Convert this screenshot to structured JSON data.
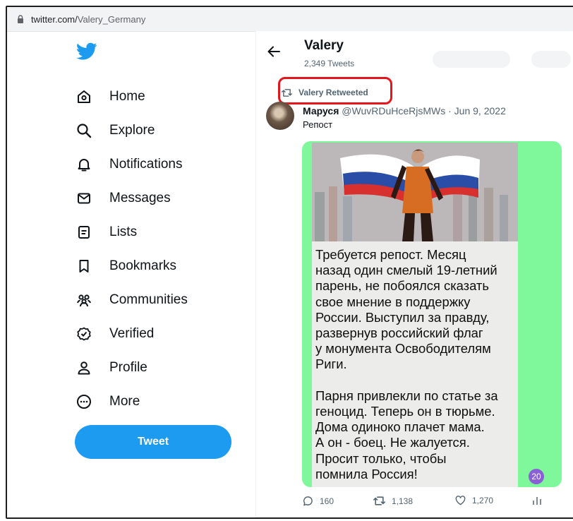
{
  "browser": {
    "url_domain": "twitter.com/",
    "url_path": "Valery_Germany"
  },
  "sidebar": {
    "items": [
      {
        "label": "Home",
        "icon": "home-icon"
      },
      {
        "label": "Explore",
        "icon": "search-icon"
      },
      {
        "label": "Notifications",
        "icon": "bell-icon"
      },
      {
        "label": "Messages",
        "icon": "envelope-icon"
      },
      {
        "label": "Lists",
        "icon": "list-icon"
      },
      {
        "label": "Bookmarks",
        "icon": "bookmark-icon"
      },
      {
        "label": "Communities",
        "icon": "communities-icon"
      },
      {
        "label": "Verified",
        "icon": "verified-icon"
      },
      {
        "label": "Profile",
        "icon": "profile-icon"
      },
      {
        "label": "More",
        "icon": "more-icon"
      }
    ],
    "tweet_button": "Tweet"
  },
  "header": {
    "name": "Valery",
    "tweet_count": "2,349 Tweets"
  },
  "tweet": {
    "retweet_label": "Valery Retweeted",
    "author_name": "Маруся",
    "author_meta": " @WuvRDuHceRjsMWs · Jun 9, 2022",
    "text": "Репост",
    "image_text": "Требуется репост.  Месяц\nназад один смелый 19-летний\nпарень, не побоялся сказать\nсвое мнение в поддержку\nРоссии. Выступил за правду,\nразвернув российский флаг\nу монумента Освободителям\nРиги.\n\nПарня привлекли по статье за\nгеноцид. Теперь он в тюрьме.\nДома одиноко плачет мама.\nА он - боец. Не жалуется.\nПросит только, чтобы\nпомнила Россия!",
    "image_badge": "20",
    "replies": "160",
    "retweets": "1,138",
    "likes": "1,270"
  },
  "colors": {
    "accent": "#1d9bf0",
    "highlight": "#e3161c",
    "media_bg": "#7ef89a"
  }
}
